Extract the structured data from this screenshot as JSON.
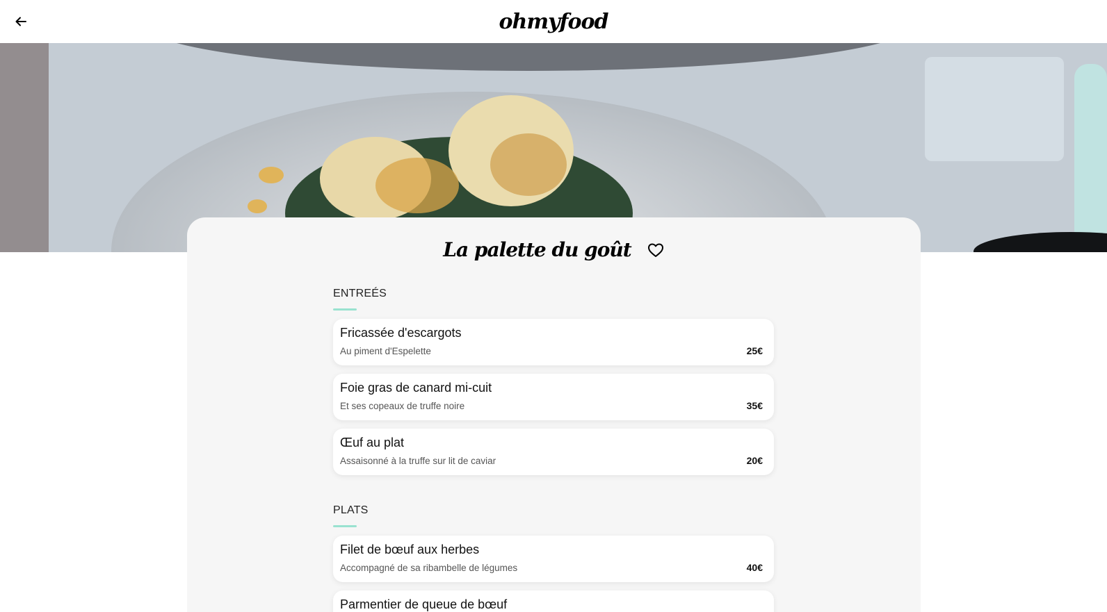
{
  "header": {
    "back_icon": "arrow-left-icon",
    "logo": "ohmyfood"
  },
  "restaurant": {
    "name": "La palette du goût",
    "favorite_icon": "heart-outline-icon"
  },
  "sections": [
    {
      "title": "ENTREÉS",
      "dishes": [
        {
          "name": "Fricassée d'escargots",
          "description": "Au piment d'Espelette",
          "price": "25€"
        },
        {
          "name": "Foie gras de canard mi-cuit",
          "description": "Et ses copeaux de truffe noire",
          "price": "35€"
        },
        {
          "name": "Œuf au plat",
          "description": "Assaisonné à la truffe sur lit de caviar",
          "price": "20€"
        }
      ]
    },
    {
      "title": "PLATS",
      "dishes": [
        {
          "name": "Filet de bœuf aux herbes",
          "description": "Accompagné de sa ribambelle de légumes",
          "price": "40€"
        },
        {
          "name": "Parmentier de queue de bœuf",
          "description": "",
          "price": ""
        }
      ]
    }
  ],
  "colors": {
    "accent": "#99e2d0",
    "panel_bg": "#f6f6f6",
    "card_bg": "#ffffff"
  }
}
